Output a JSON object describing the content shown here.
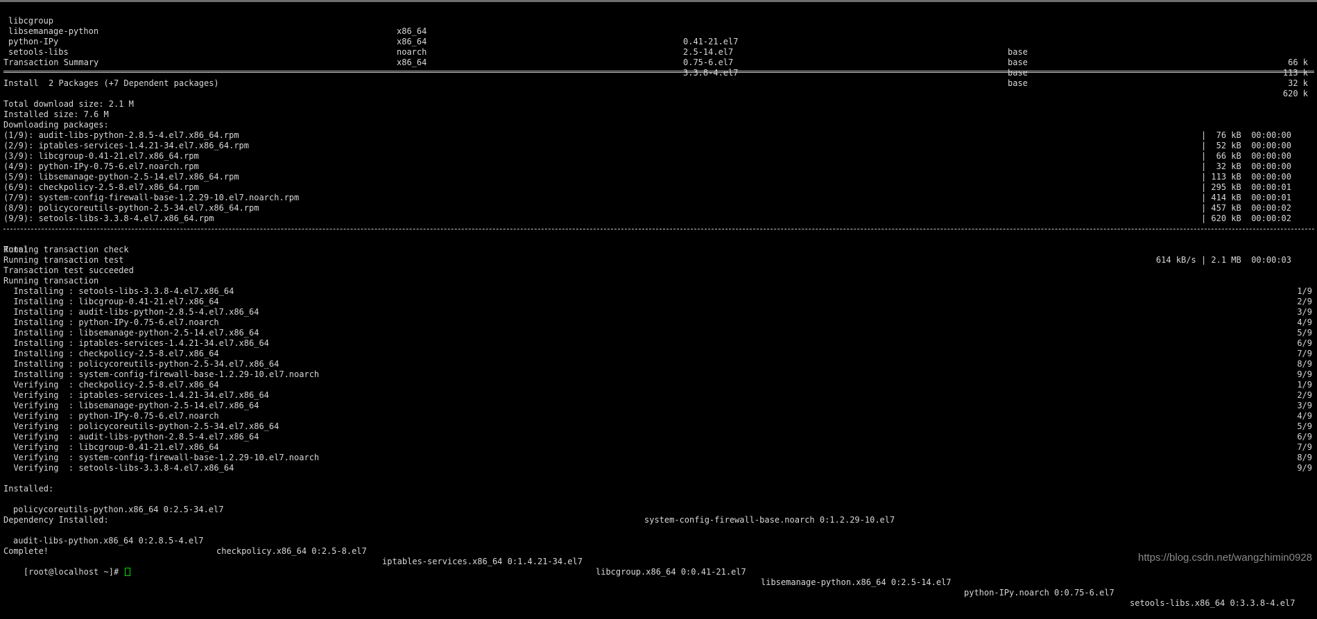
{
  "deps_table": [
    {
      "name": "libcgroup",
      "arch": "x86_64",
      "version": "0.41-21.el7",
      "repo": "base",
      "size": "66 k"
    },
    {
      "name": "libsemanage-python",
      "arch": "x86_64",
      "version": "2.5-14.el7",
      "repo": "base",
      "size": "113 k"
    },
    {
      "name": "python-IPy",
      "arch": "noarch",
      "version": "0.75-6.el7",
      "repo": "base",
      "size": "32 k"
    },
    {
      "name": "setools-libs",
      "arch": "x86_64",
      "version": "3.3.8-4.el7",
      "repo": "base",
      "size": "620 k"
    }
  ],
  "transaction_summary": "Transaction Summary",
  "install_line": "Install  2 Packages (+7 Dependent packages)",
  "total_download_size": "Total download size: 2.1 M",
  "installed_size": "Installed size: 7.6 M",
  "downloading_packages": "Downloading packages:",
  "downloads": [
    {
      "name": "(1/9): audit-libs-python-2.8.5-4.el7.x86_64.rpm",
      "stats": "|  76 kB  00:00:00"
    },
    {
      "name": "(2/9): iptables-services-1.4.21-34.el7.x86_64.rpm",
      "stats": "|  52 kB  00:00:00"
    },
    {
      "name": "(3/9): libcgroup-0.41-21.el7.x86_64.rpm",
      "stats": "|  66 kB  00:00:00"
    },
    {
      "name": "(4/9): python-IPy-0.75-6.el7.noarch.rpm",
      "stats": "|  32 kB  00:00:00"
    },
    {
      "name": "(5/9): libsemanage-python-2.5-14.el7.x86_64.rpm",
      "stats": "| 113 kB  00:00:00"
    },
    {
      "name": "(6/9): checkpolicy-2.5-8.el7.x86_64.rpm",
      "stats": "| 295 kB  00:00:01"
    },
    {
      "name": "(7/9): system-config-firewall-base-1.2.29-10.el7.noarch.rpm",
      "stats": "| 414 kB  00:00:01"
    },
    {
      "name": "(8/9): policycoreutils-python-2.5-34.el7.x86_64.rpm",
      "stats": "| 457 kB  00:00:02"
    },
    {
      "name": "(9/9): setools-libs-3.3.8-4.el7.x86_64.rpm",
      "stats": "| 620 kB  00:00:02"
    }
  ],
  "total_label": "Total",
  "total_stats": "614 kB/s | 2.1 MB  00:00:03",
  "running_lines": [
    "Running transaction check",
    "Running transaction test",
    "Transaction test succeeded",
    "Running transaction"
  ],
  "steps": [
    {
      "text": "  Installing : setools-libs-3.3.8-4.el7.x86_64",
      "count": "1/9"
    },
    {
      "text": "  Installing : libcgroup-0.41-21.el7.x86_64",
      "count": "2/9"
    },
    {
      "text": "  Installing : audit-libs-python-2.8.5-4.el7.x86_64",
      "count": "3/9"
    },
    {
      "text": "  Installing : python-IPy-0.75-6.el7.noarch",
      "count": "4/9"
    },
    {
      "text": "  Installing : libsemanage-python-2.5-14.el7.x86_64",
      "count": "5/9"
    },
    {
      "text": "  Installing : iptables-services-1.4.21-34.el7.x86_64",
      "count": "6/9"
    },
    {
      "text": "  Installing : checkpolicy-2.5-8.el7.x86_64",
      "count": "7/9"
    },
    {
      "text": "  Installing : policycoreutils-python-2.5-34.el7.x86_64",
      "count": "8/9"
    },
    {
      "text": "  Installing : system-config-firewall-base-1.2.29-10.el7.noarch",
      "count": "9/9"
    },
    {
      "text": "  Verifying  : checkpolicy-2.5-8.el7.x86_64",
      "count": "1/9"
    },
    {
      "text": "  Verifying  : iptables-services-1.4.21-34.el7.x86_64",
      "count": "2/9"
    },
    {
      "text": "  Verifying  : libsemanage-python-2.5-14.el7.x86_64",
      "count": "3/9"
    },
    {
      "text": "  Verifying  : python-IPy-0.75-6.el7.noarch",
      "count": "4/9"
    },
    {
      "text": "  Verifying  : policycoreutils-python-2.5-34.el7.x86_64",
      "count": "5/9"
    },
    {
      "text": "  Verifying  : audit-libs-python-2.8.5-4.el7.x86_64",
      "count": "6/9"
    },
    {
      "text": "  Verifying  : libcgroup-0.41-21.el7.x86_64",
      "count": "7/9"
    },
    {
      "text": "  Verifying  : system-config-firewall-base-1.2.29-10.el7.noarch",
      "count": "8/9"
    },
    {
      "text": "  Verifying  : setools-libs-3.3.8-4.el7.x86_64",
      "count": "9/9"
    }
  ],
  "installed_label": "Installed:",
  "installed": [
    "policycoreutils-python.x86_64 0:2.5-34.el7",
    "system-config-firewall-base.noarch 0:1.2.29-10.el7"
  ],
  "dependency_label": "Dependency Installed:",
  "dependencies": [
    "audit-libs-python.x86_64 0:2.8.5-4.el7",
    "checkpolicy.x86_64 0:2.5-8.el7",
    "iptables-services.x86_64 0:1.4.21-34.el7",
    "libcgroup.x86_64 0:0.41-21.el7",
    "libsemanage-python.x86_64 0:2.5-14.el7",
    "python-IPy.noarch 0:0.75-6.el7",
    "setools-libs.x86_64 0:3.3.8-4.el7"
  ],
  "complete": "Complete!",
  "prompt": "[root@localhost ~]# ",
  "watermark": "https://blog.csdn.net/wangzhimin0928",
  "colors": {
    "background": "#000000",
    "text": "#d8d8d8",
    "cursor": "#00e000"
  }
}
